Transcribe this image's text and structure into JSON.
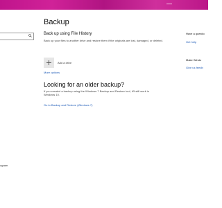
{
  "window": {
    "minimize_glyph": "—",
    "maximize_glyph": "☐",
    "close_glyph": "✕",
    "accent": "#c0148c"
  },
  "left": {
    "search_icon": "search-icon",
    "footer_text": "ogram"
  },
  "main": {
    "title": "Backup",
    "file_history": {
      "heading": "Back up using File History",
      "description": "Back up your files to another drive and restore them if the originals are lost, damaged, or deleted.",
      "add_drive_label": "Add a drive",
      "more_options": "More options"
    },
    "older": {
      "heading": "Looking for an older backup?",
      "description": "If you created a backup using the Windows 7 Backup and Restore tool, it'll still work in Windows 10.",
      "link": "Go to Backup and Restore (Windows 7)"
    }
  },
  "right": {
    "question_heading": "Have a questio",
    "get_help": "Get help",
    "make_better_heading": "Make Windo",
    "give_feedback": "Give us feedb"
  }
}
